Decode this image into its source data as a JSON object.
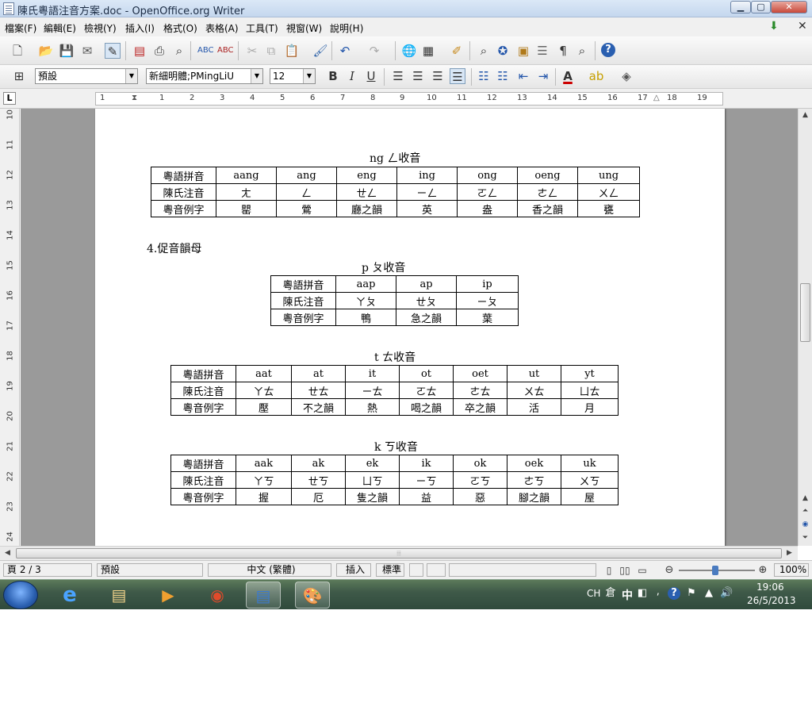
{
  "window": {
    "title": "陳氏粵語注音方案.doc - OpenOffice.org Writer",
    "min": "▁",
    "max": "▢",
    "close": "✕"
  },
  "menu": [
    "檔案(F)",
    "編輯(E)",
    "檢視(Y)",
    "插入(I)",
    "格式(O)",
    "表格(A)",
    "工具(T)",
    "視窗(W)",
    "說明(H)"
  ],
  "toolbar2": {
    "style": "預設",
    "font": "新細明體;PMingLiU",
    "size": "12",
    "bold": "B",
    "italic": "I",
    "underline": "U"
  },
  "ruler": {
    "corner": "L",
    "numbers": [
      "1",
      "1",
      "2",
      "3",
      "4",
      "5",
      "6",
      "7",
      "8",
      "9",
      "10",
      "11",
      "12",
      "13",
      "14",
      "15",
      "16",
      "17",
      "18",
      "19"
    ],
    "vnumbers": [
      "10",
      "11",
      "12",
      "13",
      "14",
      "15",
      "16",
      "17",
      "18",
      "19",
      "20",
      "21",
      "22",
      "23",
      "24"
    ]
  },
  "document": {
    "ng_title": "ng ㄥ收音",
    "ng_table": [
      [
        "粵語拼音",
        "aang",
        "ang",
        "eng",
        "ing",
        "ong",
        "oeng",
        "ung"
      ],
      [
        "陳氏注音",
        "ㄤ",
        "ㄥ",
        "ㄝㄥ",
        "ㄧㄥ",
        "ㄛㄥ",
        "ㄜㄥ",
        "ㄨㄥ"
      ],
      [
        "粵音例字",
        "罌",
        "鶯",
        "廳之韻",
        "英",
        "盎",
        "香之韻",
        "甕"
      ]
    ],
    "section4": "4.促音韻母",
    "p_title": "p ㄆ收音",
    "p_table": [
      [
        "粵語拼音",
        "aap",
        "ap",
        "ip"
      ],
      [
        "陳氏注音",
        "ㄚㄆ",
        "ㄝㄆ",
        "ㄧㄆ"
      ],
      [
        "粵音例字",
        "鴨",
        "急之韻",
        "葉"
      ]
    ],
    "t_title": "t ㄊ收音",
    "t_table": [
      [
        "粵語拼音",
        "aat",
        "at",
        "it",
        "ot",
        "oet",
        "ut",
        "yt"
      ],
      [
        "陳氏注音",
        "ㄚㄊ",
        "ㄝㄊ",
        "ㄧㄊ",
        "ㄛㄊ",
        "ㄜㄊ",
        "ㄨㄊ",
        "ㄩㄊ"
      ],
      [
        "粵音例字",
        "壓",
        "不之韻",
        "熱",
        "喝之韻",
        "卒之韻",
        "活",
        "月"
      ]
    ],
    "k_title": "k ㄎ收音",
    "k_table": [
      [
        "粵語拼音",
        "aak",
        "ak",
        "ek",
        "ik",
        "ok",
        "oek",
        "uk"
      ],
      [
        "陳氏注音",
        "ㄚㄎ",
        "ㄝㄎ",
        "ㄩㄎ",
        "ㄧㄎ",
        "ㄛㄎ",
        "ㄜㄎ",
        "ㄨㄎ"
      ],
      [
        "粵音例字",
        "握",
        "厄",
        "隻之韻",
        "益",
        "惡",
        "腳之韻",
        "屋"
      ]
    ]
  },
  "statusbar": {
    "page": "頁 2 / 3",
    "style": "預設",
    "language": "中文 (繁體)",
    "insert_mode": "插入",
    "selection_mode": "標準",
    "zoom": "100%"
  },
  "taskbar": {
    "lang": "CH",
    "ime": "中",
    "time": "19:06",
    "date": "26/5/2013"
  },
  "colors": {
    "font_color": "#cc0000",
    "highlight": "#ffff00"
  }
}
